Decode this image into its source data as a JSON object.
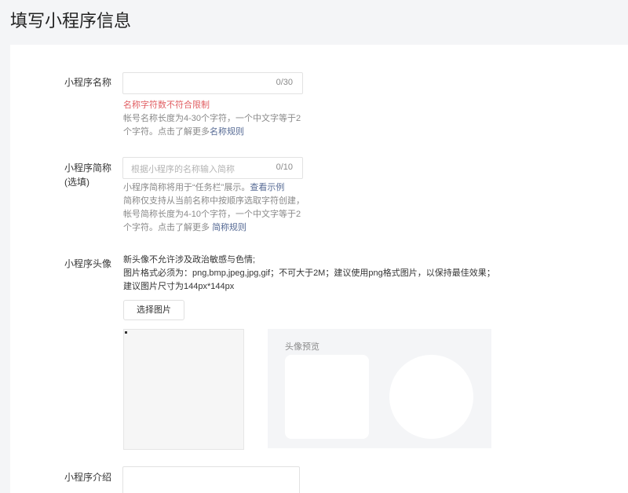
{
  "page_title": "填写小程序信息",
  "name_field": {
    "label": "小程序名称",
    "counter": "0/30",
    "error": "名称字符数不符合限制",
    "tip_line1": "帐号名称长度为4-30个字符，一个中文字等于2",
    "tip_line2": "个字符。点击了解更多",
    "tip_link": "名称规则"
  },
  "short_name_field": {
    "label": "小程序简称",
    "label_sub": "(选填)",
    "placeholder": "根据小程序的名称输入简称",
    "counter": "0/10",
    "tip_line1": "小程序简称将用于“任务栏”展示。",
    "tip_line1_link": "查看示例",
    "tip_line2": "简称仅支持从当前名称中按顺序选取字符创建，",
    "tip_line3": "帐号简称长度为4-10个字符，一个中文字等于2",
    "tip_line4": "个字符。点击了解更多 ",
    "tip_link": "简称规则"
  },
  "avatar_field": {
    "label": "小程序头像",
    "desc_line1": "新头像不允许涉及政治敏感与色情;",
    "desc_line2": "图片格式必须为：png,bmp,jpeg,jpg,gif；不可大于2M；建议使用png格式图片，以保持最佳效果；",
    "desc_line3": "建议图片尺寸为144px*144px",
    "select_button": "选择图片",
    "preview_title": "头像预览"
  },
  "intro_field": {
    "label": "小程序介绍"
  }
}
